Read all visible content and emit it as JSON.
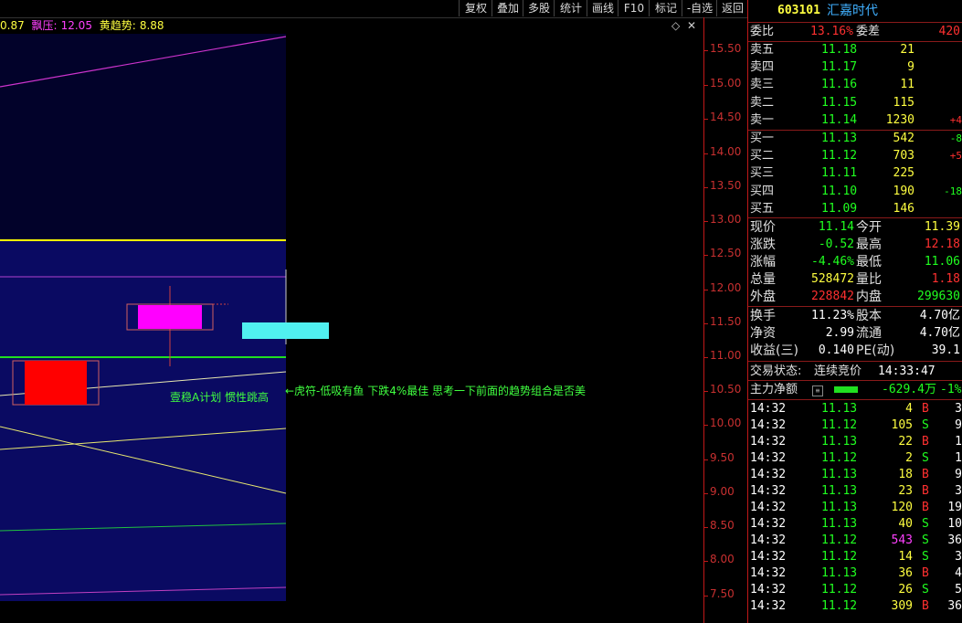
{
  "toolbar": {
    "buttons": [
      "复权",
      "叠加",
      "多股",
      "统计",
      "画线",
      "F10",
      "标记",
      "-自选",
      "返回"
    ]
  },
  "indicator": {
    "v1": "0.87",
    "pressure_label": "飘压:",
    "pressure_value": "12.05",
    "trend_label": "黄趋势:",
    "trend_value": "8.88"
  },
  "chart": {
    "annotation1": "壹稳A计划 惯性跳高",
    "annotation2": "←虎符-低吸有鱼 下跌4%最佳 思考一下前面的趋势组合是否美",
    "axis_ticks": [
      "15.50",
      "15.00",
      "14.50",
      "14.00",
      "13.50",
      "13.00",
      "12.50",
      "12.00",
      "11.50",
      "11.00",
      "10.50",
      "10.00",
      "9.50",
      "9.00",
      "8.50",
      "8.00",
      "7.50"
    ]
  },
  "quote": {
    "code": "603101",
    "name": "汇嘉时代",
    "ratio_label": "委比",
    "ratio_value": "13.16%",
    "diff_label": "委差",
    "diff_value": "420",
    "sells": [
      {
        "label": "卖五",
        "price": "11.18",
        "vol": "21",
        "chg": ""
      },
      {
        "label": "卖四",
        "price": "11.17",
        "vol": "9",
        "chg": ""
      },
      {
        "label": "卖三",
        "price": "11.16",
        "vol": "11",
        "chg": ""
      },
      {
        "label": "卖二",
        "price": "11.15",
        "vol": "115",
        "chg": ""
      },
      {
        "label": "卖一",
        "price": "11.14",
        "vol": "1230",
        "chg": "+4"
      }
    ],
    "buys": [
      {
        "label": "买一",
        "price": "11.13",
        "vol": "542",
        "chg": "-8"
      },
      {
        "label": "买二",
        "price": "11.12",
        "vol": "703",
        "chg": "+5"
      },
      {
        "label": "买三",
        "price": "11.11",
        "vol": "225",
        "chg": ""
      },
      {
        "label": "买四",
        "price": "11.10",
        "vol": "190",
        "chg": "-18"
      },
      {
        "label": "买五",
        "price": "11.09",
        "vol": "146",
        "chg": ""
      }
    ],
    "stats1": [
      {
        "l1": "现价",
        "v1": "11.14",
        "l2": "今开",
        "v2": "11.39"
      },
      {
        "l1": "涨跌",
        "v1": "-0.52",
        "l2": "最高",
        "v2": "12.18"
      },
      {
        "l1": "涨幅",
        "v1": "-4.46%",
        "l2": "最低",
        "v2": "11.06"
      },
      {
        "l1": "总量",
        "v1": "528472",
        "l2": "量比",
        "v2": "1.18"
      },
      {
        "l1": "外盘",
        "v1": "228842",
        "l2": "内盘",
        "v2": "299630"
      }
    ],
    "stats2": [
      {
        "l1": "换手",
        "v1": "11.23%",
        "l2": "股本",
        "v2": "4.70亿"
      },
      {
        "l1": "净资",
        "v1": "2.99",
        "l2": "流通",
        "v2": "4.70亿"
      },
      {
        "l1": "收益(三)",
        "v1": "0.140",
        "l2": "PE(动)",
        "v2": "39.1"
      }
    ],
    "trade_status_label": "交易状态:",
    "trade_status_value": "连续竞价",
    "trade_time": "14:33:47",
    "main_flow_label": "主力净额",
    "main_flow_value": "-629.4万",
    "main_flow_pct": "-1%"
  },
  "ticks": [
    {
      "t": "14:32",
      "p": "11.13",
      "v": "4",
      "s": "B",
      "n": "3"
    },
    {
      "t": "14:32",
      "p": "11.12",
      "v": "105",
      "s": "S",
      "n": "9"
    },
    {
      "t": "14:32",
      "p": "11.13",
      "v": "22",
      "s": "B",
      "n": "1"
    },
    {
      "t": "14:32",
      "p": "11.12",
      "v": "2",
      "s": "S",
      "n": "1"
    },
    {
      "t": "14:32",
      "p": "11.13",
      "v": "18",
      "s": "B",
      "n": "9"
    },
    {
      "t": "14:32",
      "p": "11.13",
      "v": "23",
      "s": "B",
      "n": "3"
    },
    {
      "t": "14:32",
      "p": "11.13",
      "v": "120",
      "s": "B",
      "n": "19"
    },
    {
      "t": "14:32",
      "p": "11.13",
      "v": "40",
      "s": "S",
      "n": "10"
    },
    {
      "t": "14:32",
      "p": "11.12",
      "v": "543",
      "s": "S",
      "n": "36"
    },
    {
      "t": "14:32",
      "p": "11.12",
      "v": "14",
      "s": "S",
      "n": "3"
    },
    {
      "t": "14:32",
      "p": "11.13",
      "v": "36",
      "s": "B",
      "n": "4"
    },
    {
      "t": "14:32",
      "p": "11.12",
      "v": "26",
      "s": "S",
      "n": "5"
    },
    {
      "t": "14:32",
      "p": "11.12",
      "v": "309",
      "s": "B",
      "n": "36"
    }
  ]
}
